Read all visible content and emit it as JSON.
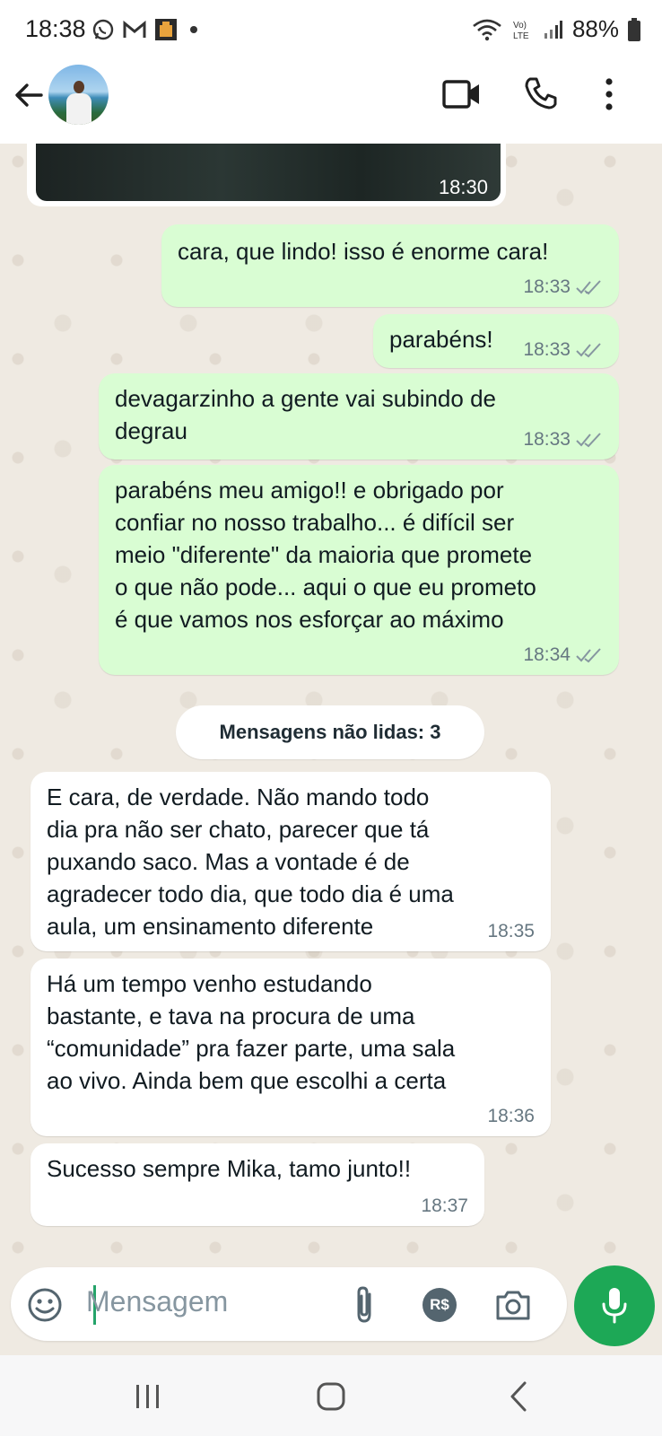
{
  "status_bar": {
    "time": "18:38",
    "battery": "88%",
    "icons": [
      "whatsapp-icon",
      "gmail-icon",
      "app-notification-icon",
      "wifi-icon",
      "volte-icon",
      "signal-icon",
      "battery-icon"
    ]
  },
  "header": {
    "back_icon": "arrow-left-icon",
    "actions": [
      "video-call-icon",
      "voice-call-icon",
      "more-options-icon"
    ]
  },
  "messages": [
    {
      "direction": "incoming-photo",
      "time": "18:30"
    },
    {
      "direction": "outgoing",
      "text": "cara, que lindo! isso é enorme cara!",
      "time": "18:33",
      "status": "delivered"
    },
    {
      "direction": "outgoing",
      "text": "parabéns!",
      "time": "18:33",
      "status": "delivered"
    },
    {
      "direction": "outgoing",
      "text": "devagarzinho a gente vai subindo de\ndegrau",
      "time": "18:33",
      "status": "delivered"
    },
    {
      "direction": "outgoing",
      "text": "parabéns meu amigo!! e obrigado por\nconfiar no nosso trabalho... é difícil ser\nmeio \"diferente\" da maioria que promete\no que não pode... aqui o que eu prometo\né que vamos nos esforçar ao máximo",
      "time": "18:34",
      "status": "delivered"
    },
    {
      "direction": "incoming",
      "text": "E cara, de verdade. Não mando todo\ndia pra não ser chato, parecer que tá\npuxando saco. Mas a vontade é de\nagradecer todo dia, que todo dia é uma\naula, um ensinamento diferente",
      "time": "18:35"
    },
    {
      "direction": "incoming",
      "text": "Há um tempo venho estudando\nbastante, e tava na procura de uma\n“comunidade” pra fazer parte, uma sala\nao vivo. Ainda bem que escolhi a certa",
      "time": "18:36"
    },
    {
      "direction": "incoming",
      "text": "Sucesso sempre Mika, tamo junto!!",
      "time": "18:37"
    }
  ],
  "unread_banner": "Mensagens não lidas: 3",
  "composer": {
    "placeholder": "Mensagem",
    "payment_label": "R$",
    "icons": [
      "emoji-icon",
      "attach-icon",
      "payment-icon",
      "camera-icon",
      "mic-icon"
    ]
  },
  "navigation": [
    "recent-apps-icon",
    "home-icon",
    "back-icon"
  ],
  "colors": {
    "outgoing_bubble": "#d9fdd3",
    "incoming_bubble": "#ffffff",
    "chat_background": "#efeae2",
    "accent_green": "#1da856",
    "read_ticks": "#8696a0"
  }
}
